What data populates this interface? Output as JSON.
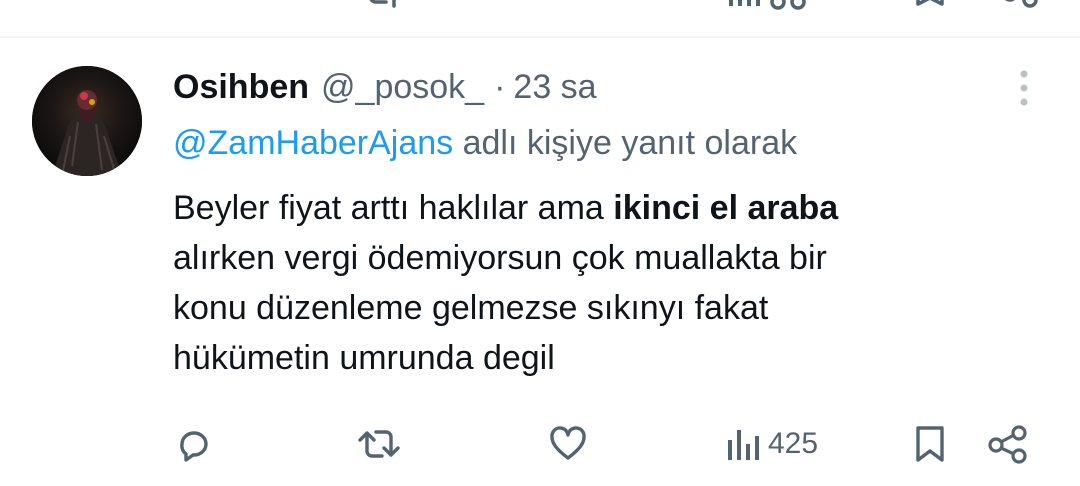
{
  "tweet": {
    "display_name": "Osihben",
    "handle": "@_posok_",
    "separator": "·",
    "time": "23 sa",
    "reply_mention": "@ZamHaberAjans",
    "reply_suffix": " adlı kişiye yanıt olarak",
    "body": {
      "line1_start": "Beyler fiyat arttı haklılar ama ",
      "line1_bold": "ikinci el araba",
      "line2": "alırken vergi ödemiyorsun çok muallakta bir",
      "line3": "konu düzenleme gelmezse sıkınyı fakat",
      "line4": "hükümetin umrunda degil"
    },
    "views": "425"
  },
  "icons": {
    "avatar": "avatar",
    "more": "more-vertical-icon",
    "reply": "reply-icon",
    "retweet": "retweet-icon",
    "like": "heart-icon",
    "views": "views-chart-icon",
    "bookmark": "bookmark-icon",
    "share": "share-icon"
  },
  "colors": {
    "text_primary": "#0f1419",
    "text_secondary": "#536471",
    "link": "#1d9bf0",
    "divider": "#eff3f4"
  }
}
